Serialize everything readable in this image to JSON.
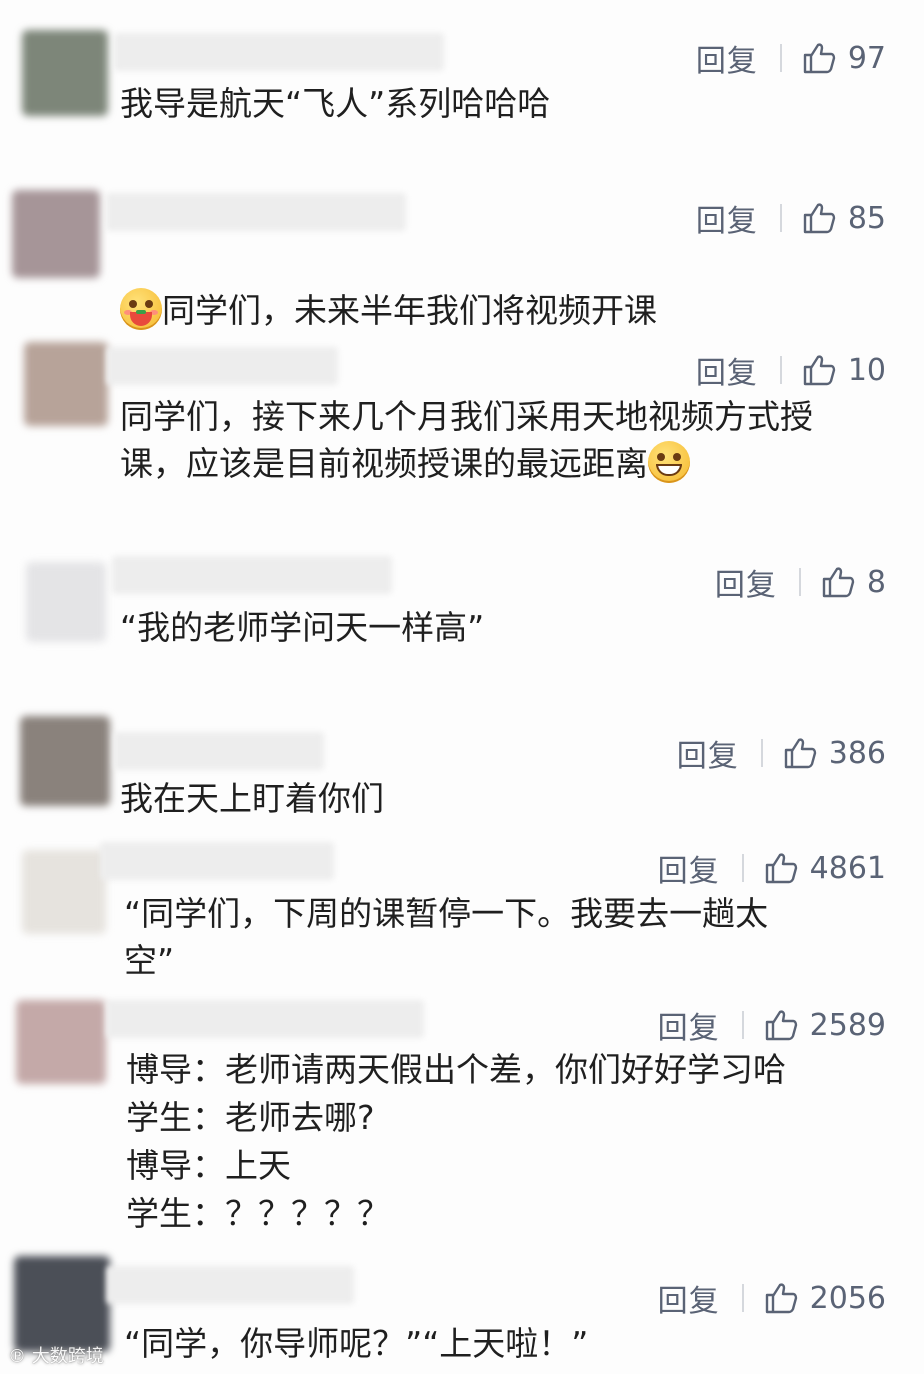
{
  "reply_label": "回复",
  "colors": {
    "action_text": "#5a6375",
    "comment_text": "#1f1f1f",
    "background": "#fdfdfd"
  },
  "icons": {
    "like": "thumbs-up-icon"
  },
  "comments": [
    {
      "text": "我导是航天“飞人”系列哈哈哈",
      "likes": "97",
      "avatar_color": "#7d8679"
    },
    {
      "text": "同学们，未来半年我们将视频开课",
      "emoji_before": "grinning-face-eating-watermelon-emoji",
      "likes": "85",
      "avatar_color": "#a69598"
    },
    {
      "text": "同学们，接下来几个月我们采用天地视频方式授\n课，应该是目前视频授课的最远距离",
      "emoji_after": "beaming-face-emoji",
      "likes": "10",
      "avatar_color": "#b7a399"
    },
    {
      "text": "“我的老师学问天一样高”",
      "likes": "8",
      "avatar_color": "#e4e4e6"
    },
    {
      "text": "我在天上盯着你们",
      "likes": "386",
      "avatar_color": "#8a827c"
    },
    {
      "text": "“同学们，下周的课暂停一下。我要去一趟太\n空”",
      "likes": "4861",
      "avatar_color": "#e6e3de"
    },
    {
      "text": "博导：老师请两天假出个差，你们好好学习哈\n学生：老师去哪?\n博导：上天\n学生：？？？？？",
      "likes": "2589",
      "avatar_color": "#c4a9a8"
    },
    {
      "text": "“同学，你导师呢？”“上天啦！”",
      "likes": "2056",
      "avatar_color": "#4b4f57"
    }
  ],
  "watermark": "大数跨境"
}
